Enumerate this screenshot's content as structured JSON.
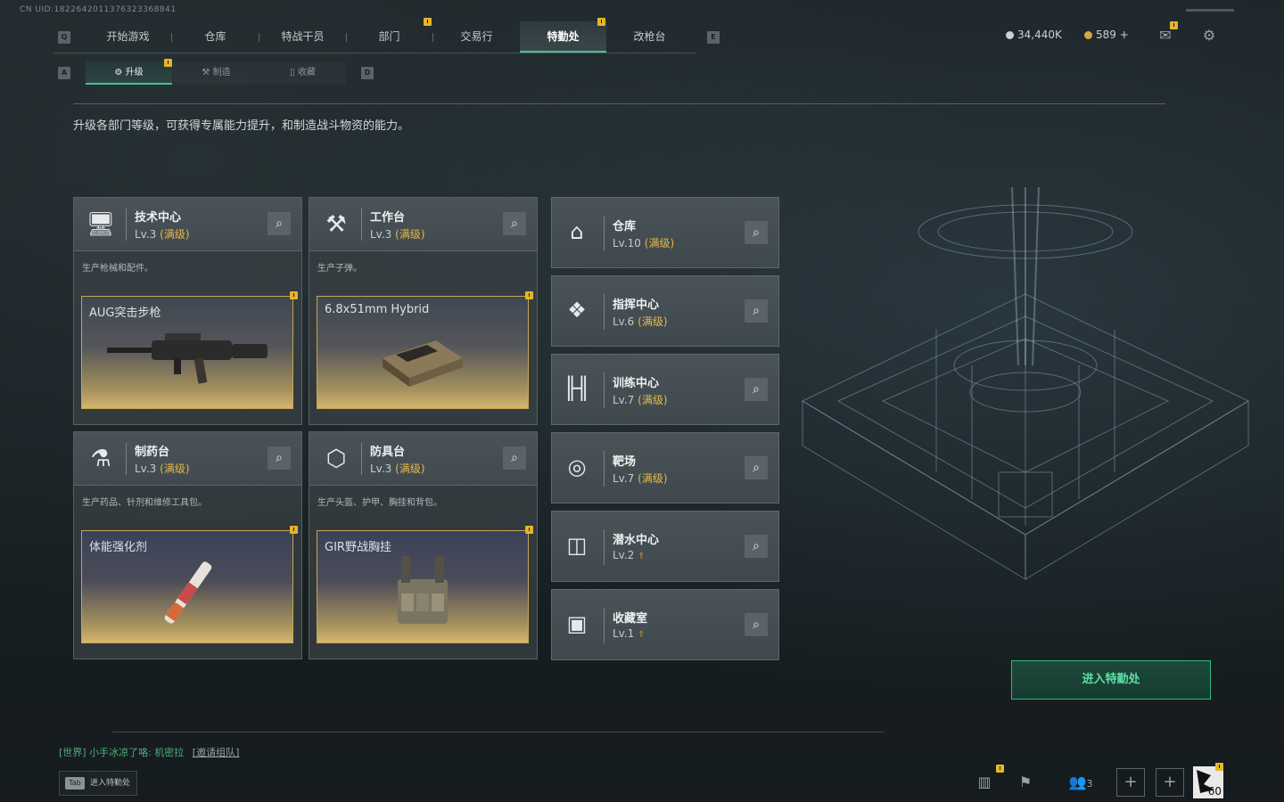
{
  "uid": "CN UID:1822642011376323368841",
  "nav": {
    "left_key": "Q",
    "right_key": "E",
    "tabs": [
      "开始游戏",
      "仓库",
      "特战干员",
      "部门",
      "交易行",
      "特勤处",
      "改枪台"
    ],
    "active": "特勤处"
  },
  "currency": {
    "coins": "34,440K",
    "tokens": "589 +",
    "coin_color": "#c9cfd2",
    "token_color": "#d6a747"
  },
  "subnav": {
    "left_key": "A",
    "right_key": "D",
    "tabs": [
      {
        "label": "升级",
        "icon": "upgrade-icon"
      },
      {
        "label": "制造",
        "icon": "craft-icon"
      },
      {
        "label": "收藏",
        "icon": "collection-icon"
      }
    ]
  },
  "description": "升级各部门等级，可获得专属能力提升，和制造战斗物资的能力。",
  "big_cards": [
    {
      "title": "技术中心",
      "level": "Lv.3",
      "max": "(满级)",
      "sub": "生产枪械和配件。",
      "item": "AUG突击步枪",
      "icon": "tech-center-icon"
    },
    {
      "title": "工作台",
      "level": "Lv.3",
      "max": "(满级)",
      "sub": "生产子弹。",
      "item": "6.8x51mm Hybrid",
      "icon": "workbench-icon"
    },
    {
      "title": "制药台",
      "level": "Lv.3",
      "max": "(满级)",
      "sub": "生产药品、针剂和维修工具包。",
      "item": "体能强化剂",
      "icon": "pharmacy-icon"
    },
    {
      "title": "防具台",
      "level": "Lv.3",
      "max": "(满级)",
      "sub": "生产头盔、护甲、胸挂和背包。",
      "item": "GIR野战胸挂",
      "icon": "armor-bench-icon"
    }
  ],
  "small_cards": [
    {
      "title": "仓库",
      "level": "Lv.10",
      "max": "(满级)",
      "icon": "warehouse-icon"
    },
    {
      "title": "指挥中心",
      "level": "Lv.6",
      "max": "(满级)",
      "icon": "command-center-icon"
    },
    {
      "title": "训练中心",
      "level": "Lv.7",
      "max": "(满级)",
      "icon": "training-icon"
    },
    {
      "title": "靶场",
      "level": "Lv.7",
      "max": "(满级)",
      "icon": "shooting-range-icon"
    },
    {
      "title": "潜水中心",
      "level": "Lv.2",
      "max": "",
      "icon": "diving-icon"
    },
    {
      "title": "收藏室",
      "level": "Lv.1",
      "max": "",
      "icon": "collection-room-icon"
    }
  ],
  "enter_button": "进入特勤处",
  "chat": {
    "channel": "[世界]",
    "message": "小手冰凉了咯: 机密拉",
    "link": "[邀请组队]"
  },
  "tab_hint": {
    "key": "Tab",
    "label": "进入特勤处"
  },
  "bottom": {
    "friends_count": "3",
    "level": "60"
  },
  "accent_color": "#3ec58e",
  "gold_color": "#e3b84a"
}
